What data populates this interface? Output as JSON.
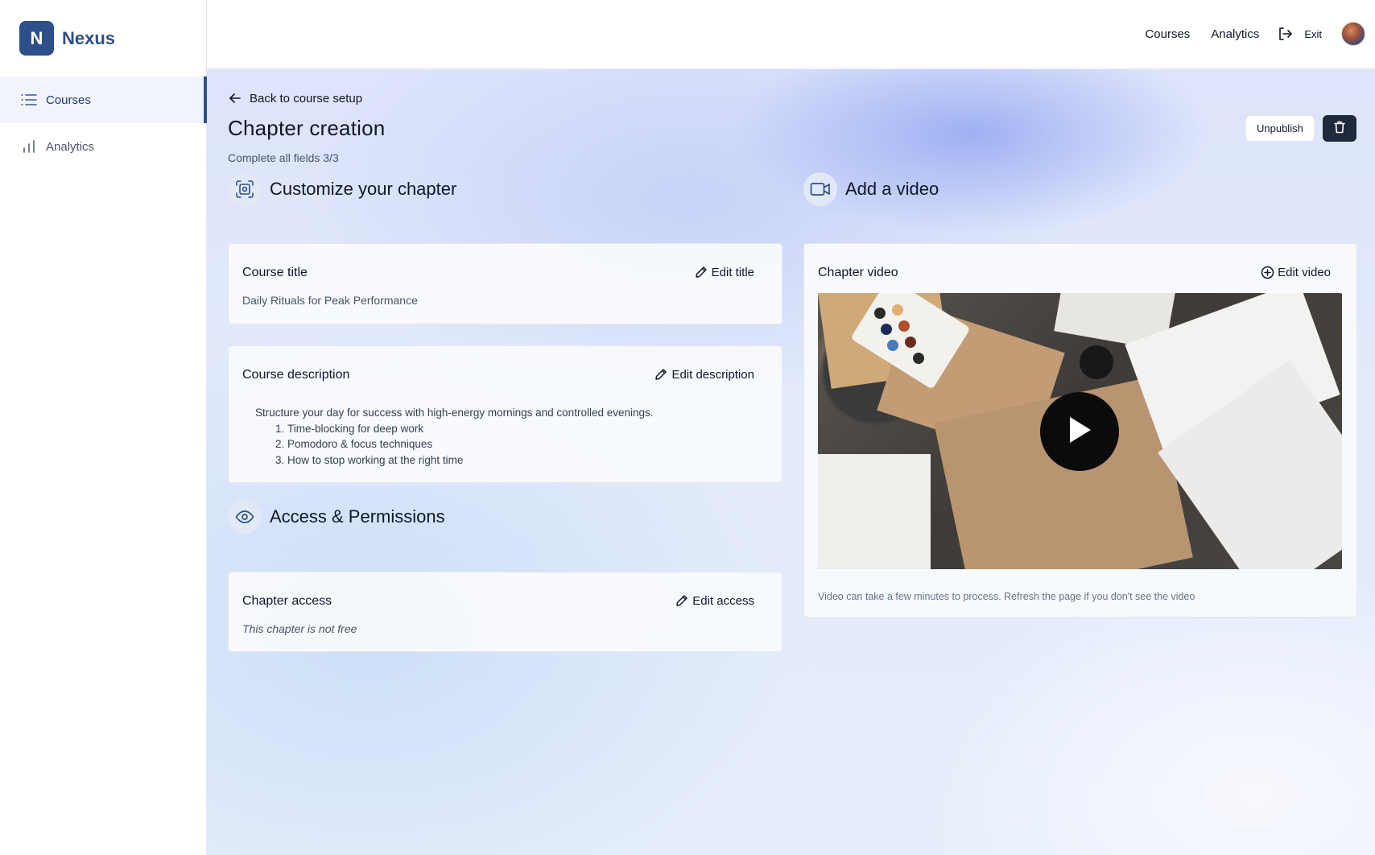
{
  "brand": {
    "logo_letter": "N",
    "name": "Nexus",
    "color": "#2d4f8c"
  },
  "sidebar": {
    "items": [
      {
        "label": "Courses",
        "icon": "list-icon",
        "active": true
      },
      {
        "label": "Analytics",
        "icon": "bar-chart-icon",
        "active": false
      }
    ]
  },
  "header": {
    "links": [
      "Courses",
      "Analytics"
    ],
    "exit_label": "Exit"
  },
  "page": {
    "back_label": "Back to course setup",
    "title": "Chapter creation",
    "subtitle": "Complete all fields 3/3",
    "unpublish_label": "Unpublish"
  },
  "customize": {
    "heading": "Customize your chapter",
    "title_card": {
      "label": "Course title",
      "action": "Edit title",
      "value": "Daily Rituals for Peak Performance"
    },
    "description_card": {
      "label": "Course description",
      "action": "Edit description",
      "intro": "Structure your day for success with high-energy mornings and controlled evenings.",
      "items": [
        "Time-blocking for deep work",
        "Pomodoro & focus techniques",
        "How to stop working at the right time"
      ]
    }
  },
  "access": {
    "heading": "Access & Permissions",
    "card": {
      "label": "Chapter access",
      "action": "Edit access",
      "value": "This chapter is not free"
    }
  },
  "video": {
    "heading": "Add a video",
    "card": {
      "label": "Chapter video",
      "action": "Edit video",
      "note": "Video can take a few minutes to process. Refresh the page if you don't see the video"
    }
  }
}
